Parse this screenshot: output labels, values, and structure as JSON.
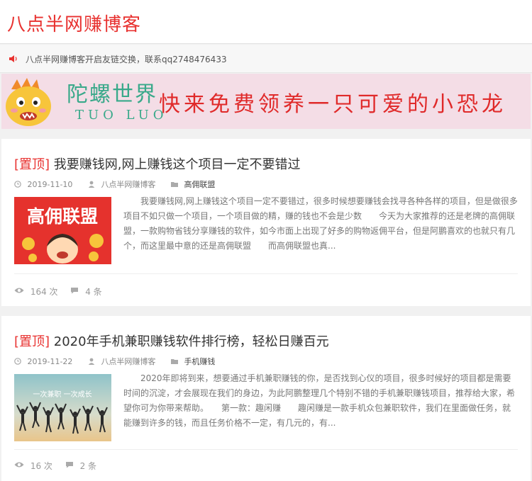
{
  "site": {
    "title": "八点半网赚博客"
  },
  "notice": {
    "text": "八点半网赚博客开启友链交换，联系qq2748476433"
  },
  "banner": {
    "brand": "陀螺世界",
    "brand_en": "TUO   LUO",
    "slogan": "快来免费领养一只可爱的小恐龙"
  },
  "posts": [
    {
      "pin": "[置顶]",
      "title": "我要赚钱网,网上赚钱这个项目一定不要错过",
      "date": "2019-11-10",
      "author": "八点半网赚博客",
      "category": "高佣联盟",
      "thumb_text": "高佣联盟",
      "excerpt": "我要赚钱网,网上赚钱这个项目一定不要错过，很多时候想要赚钱会找寻各种各样的项目，但是做很多项目不如只做一个项目，一个项目做的精，赚的钱也不会是少数　　今天为大家推荐的还是老牌的高佣联盟，一款购物省钱分享赚钱的软件，如今市面上出现了好多的购物返佣平台，但是阿鹏喜欢的也就只有几个，而这里最中意的还是高佣联盟　　而高佣联盟也真...",
      "views": "164 次",
      "comments": "4 条"
    },
    {
      "pin": "[置顶]",
      "title": "2020年手机兼职赚钱软件排行榜，轻松日赚百元",
      "date": "2019-11-22",
      "author": "八点半网赚博客",
      "category": "手机赚钱",
      "thumb_text": "一次兼职 一次成长",
      "excerpt": "2020年即将到来，想要通过手机兼职赚钱的你，是否找到心仪的项目，很多时候好的项目都是需要时间的沉淀，才会展现在我们的身边，为此阿鹏整理几个特别不错的手机兼职赚钱项目，推荐给大家，希望你可为你带来帮助。　　第一款：趣闲赚　　趣闲赚是一款手机众包兼职软件，我们在里面做任务，就能赚到许多的钱，而且任务价格不一定，有几元的，有...",
      "views": "16 次",
      "comments": "2 条"
    }
  ]
}
